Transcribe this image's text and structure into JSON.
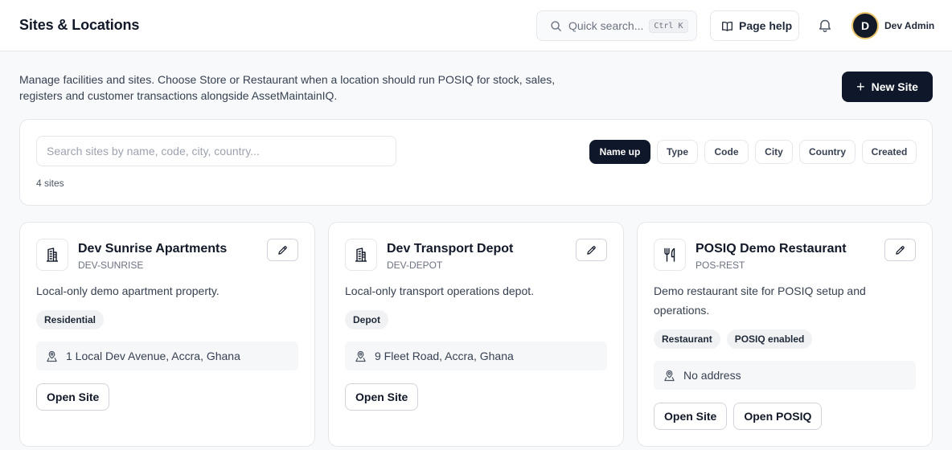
{
  "header": {
    "title": "Sites & Locations",
    "search_label": "Quick search...",
    "search_shortcut": "Ctrl K",
    "help_label": "Page help",
    "user_initial": "D",
    "user_name": "Dev Admin"
  },
  "intro": {
    "description": "Manage facilities and sites. Choose Store or Restaurant when a location should run POSIQ for stock, sales, registers and customer transactions alongside AssetMaintainIQ.",
    "new_site_label": "New Site"
  },
  "filters": {
    "search_placeholder": "Search sites by name, code, city, country...",
    "sort_options": [
      "Name up",
      "Type",
      "Code",
      "City",
      "Country",
      "Created"
    ],
    "active_sort": "Name up",
    "count_text": "4 sites"
  },
  "sites": [
    {
      "name": "Dev Sunrise Apartments",
      "code": "DEV-SUNRISE",
      "icon": "building-icon",
      "description": "Local-only demo apartment property.",
      "tags": [
        "Residential"
      ],
      "address": "1 Local Dev Avenue, Accra, Ghana",
      "actions": [
        "Open Site"
      ]
    },
    {
      "name": "Dev Transport Depot",
      "code": "DEV-DEPOT",
      "icon": "building-icon",
      "description": "Local-only transport operations depot.",
      "tags": [
        "Depot"
      ],
      "address": "9 Fleet Road, Accra, Ghana",
      "actions": [
        "Open Site"
      ]
    },
    {
      "name": "POSIQ Demo Restaurant",
      "code": "POS-REST",
      "icon": "utensils-icon",
      "description": "Demo restaurant site for POSIQ setup and operations.",
      "tags": [
        "Restaurant",
        "POSIQ enabled"
      ],
      "address": "No address",
      "actions": [
        "Open Site",
        "Open POSIQ"
      ]
    }
  ],
  "colors": {
    "primary": "#0f172a",
    "avatar_ring": "#e9c46a",
    "border": "#e5e7eb",
    "background": "#f8f9fb"
  }
}
